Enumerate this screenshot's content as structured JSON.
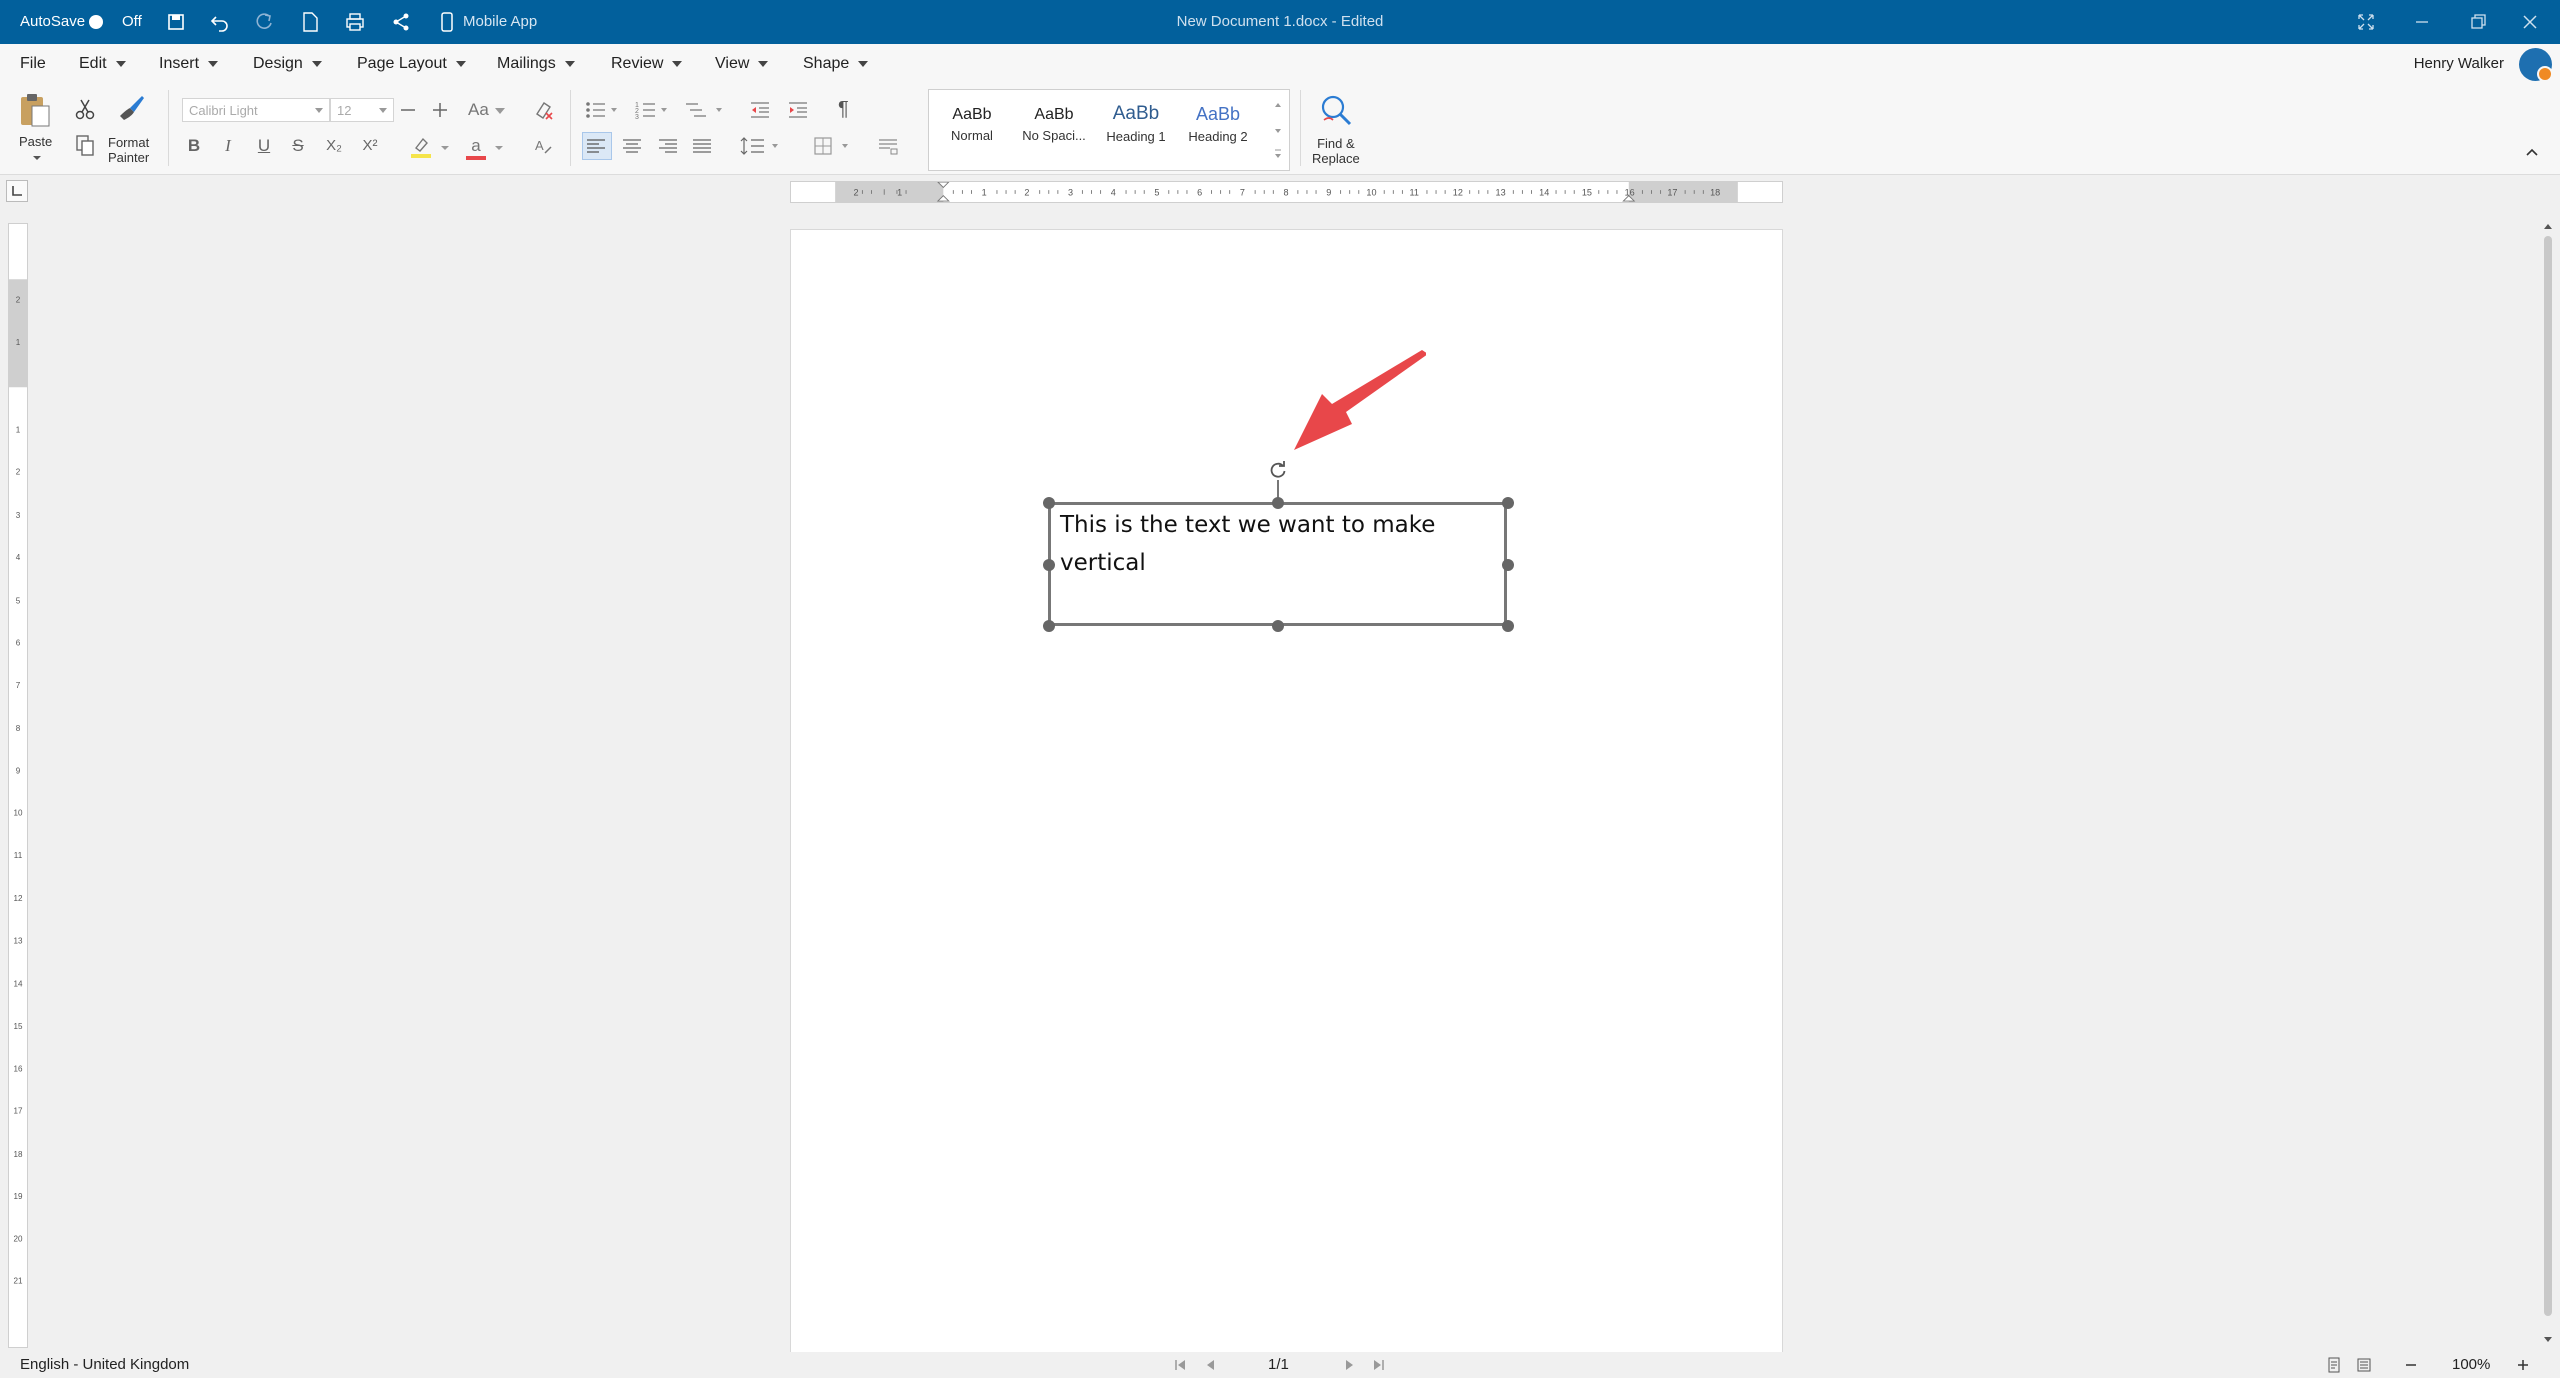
{
  "titlebar": {
    "autosave_label": "AutoSave",
    "autosave_state": "Off",
    "mobile_app_label": "Mobile App",
    "document_title": "New Document 1.docx - Edited"
  },
  "menubar": {
    "items": [
      "File",
      "Edit",
      "Insert",
      "Design",
      "Page Layout",
      "Mailings",
      "Review",
      "View",
      "Shape"
    ],
    "user_name": "Henry Walker"
  },
  "ribbon": {
    "paste_label": "Paste",
    "format_painter_label_1": "Format",
    "format_painter_label_2": "Painter",
    "font_name": "Calibri Light",
    "font_size": "12",
    "change_case_label": "Aa",
    "bold": "B",
    "italic": "I",
    "underline": "U",
    "strikethrough": "S",
    "subscript": "X₂",
    "superscript": "X²",
    "font_color_letter": "a",
    "pilcrow": "¶",
    "styles": [
      {
        "sample": "AaBb",
        "name": "Normal"
      },
      {
        "sample": "AaBb",
        "name": "No Spaci..."
      },
      {
        "sample": "AaBb",
        "name": "Heading 1"
      },
      {
        "sample": "AaBb",
        "name": "Heading 2"
      }
    ],
    "find_replace_label_1": "Find &",
    "find_replace_label_2": "Replace"
  },
  "document": {
    "textbox_text": "This is the text we want to make vertical"
  },
  "statusbar": {
    "language": "English - United Kingdom",
    "page_indicator": "1/1",
    "zoom": "100%"
  },
  "colors": {
    "titlebar_bg": "#02609c",
    "arrow_annotation": "#e8474a",
    "highlight": "#f5e44a",
    "font_color_underline": "#e8474a"
  },
  "icons": [
    "save-icon",
    "undo-icon",
    "redo-icon",
    "new-document-icon",
    "print-icon",
    "share-icon",
    "phone-icon",
    "fullscreen-icon",
    "minimize-icon",
    "restore-icon",
    "close-icon",
    "paste-icon",
    "cut-icon",
    "copy-icon",
    "format-painter-icon",
    "clear-formatting-icon",
    "bullets-icon",
    "numbering-icon",
    "multilevel-list-icon",
    "decrease-indent-icon",
    "increase-indent-icon",
    "align-left-icon",
    "align-center-icon",
    "align-right-icon",
    "justify-icon",
    "line-spacing-icon",
    "borders-icon",
    "paragraph-settings-icon",
    "find-replace-icon",
    "collapse-ribbon-icon",
    "rotate-icon",
    "arrow-annotation",
    "print-layout-icon",
    "web-layout-icon",
    "zoom-out-icon",
    "zoom-in-icon"
  ]
}
